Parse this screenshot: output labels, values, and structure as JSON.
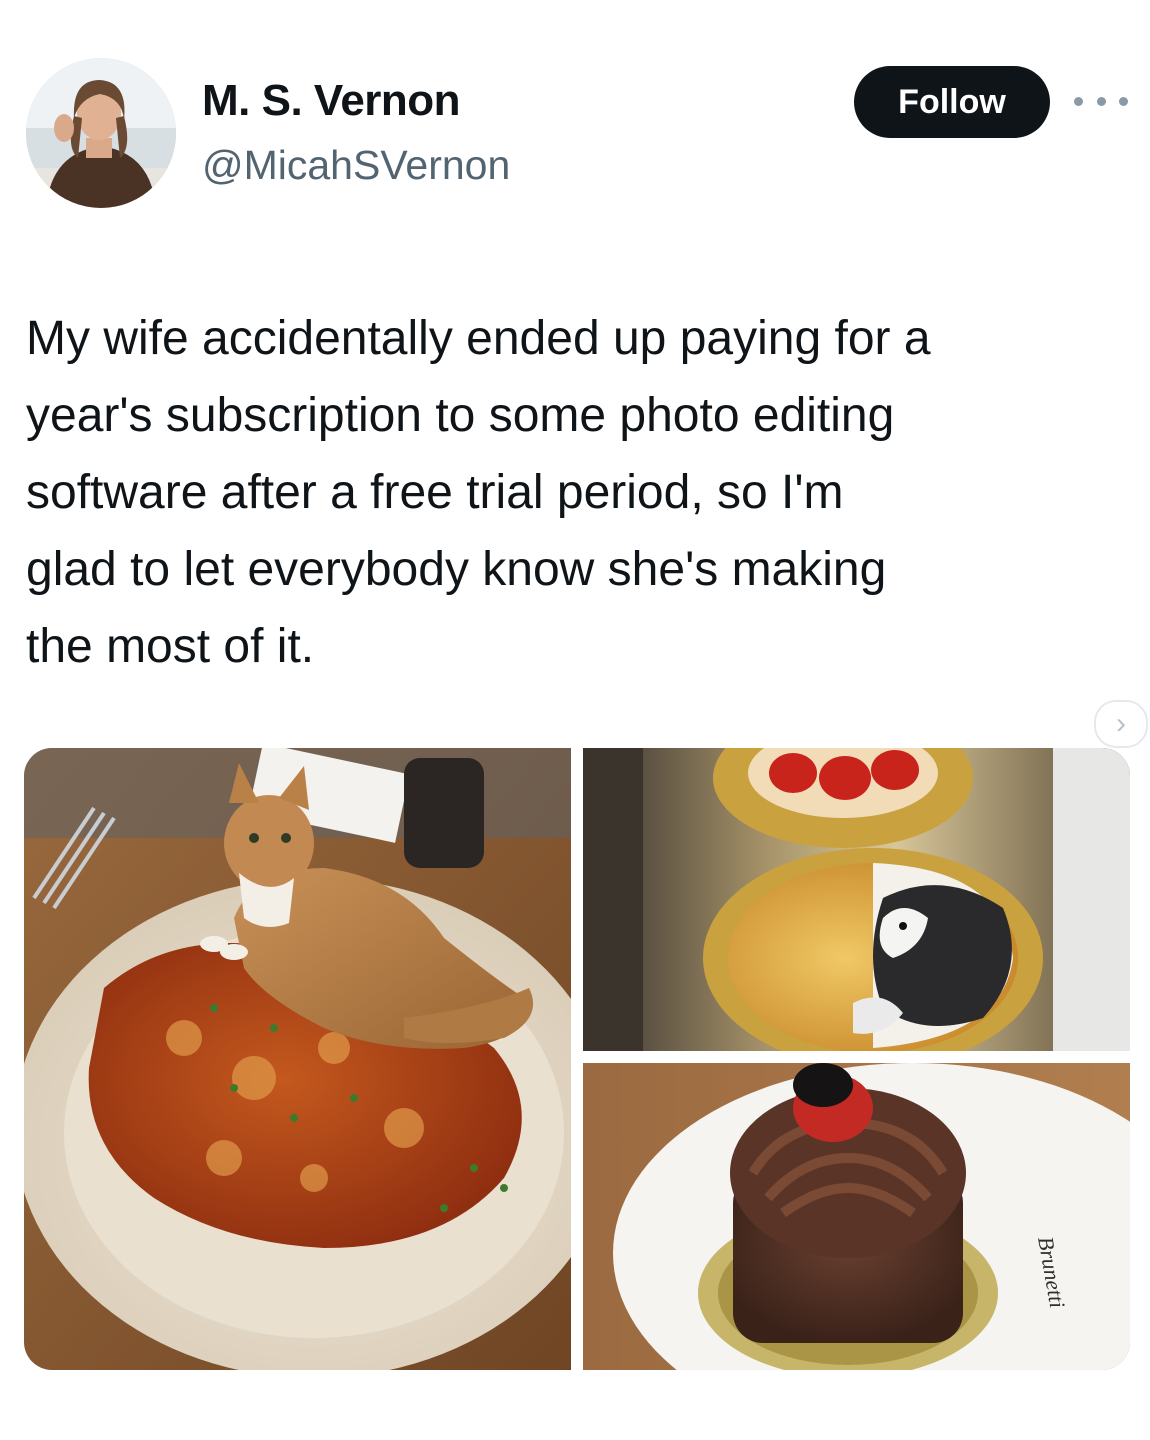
{
  "author": {
    "display_name": "M. S. Vernon",
    "handle": "@MicahSVernon",
    "avatar_icon": "user-avatar"
  },
  "actions": {
    "follow_label": "Follow",
    "more_icon": "more-options-icon"
  },
  "tweet": {
    "text": "My wife accidentally ended up paying for a\nyear's subscription to some photo editing\nsoftware after a free trial period, so I'm\nglad to let everybody know she's making\nthe most of it."
  },
  "media": {
    "next_icon": "chevron-right-icon",
    "next_glyph": "›",
    "plate_brand": "Brunetti"
  },
  "colors": {
    "follow_bg": "#0f1419",
    "handle": "#536471",
    "text": "#0f1419"
  }
}
